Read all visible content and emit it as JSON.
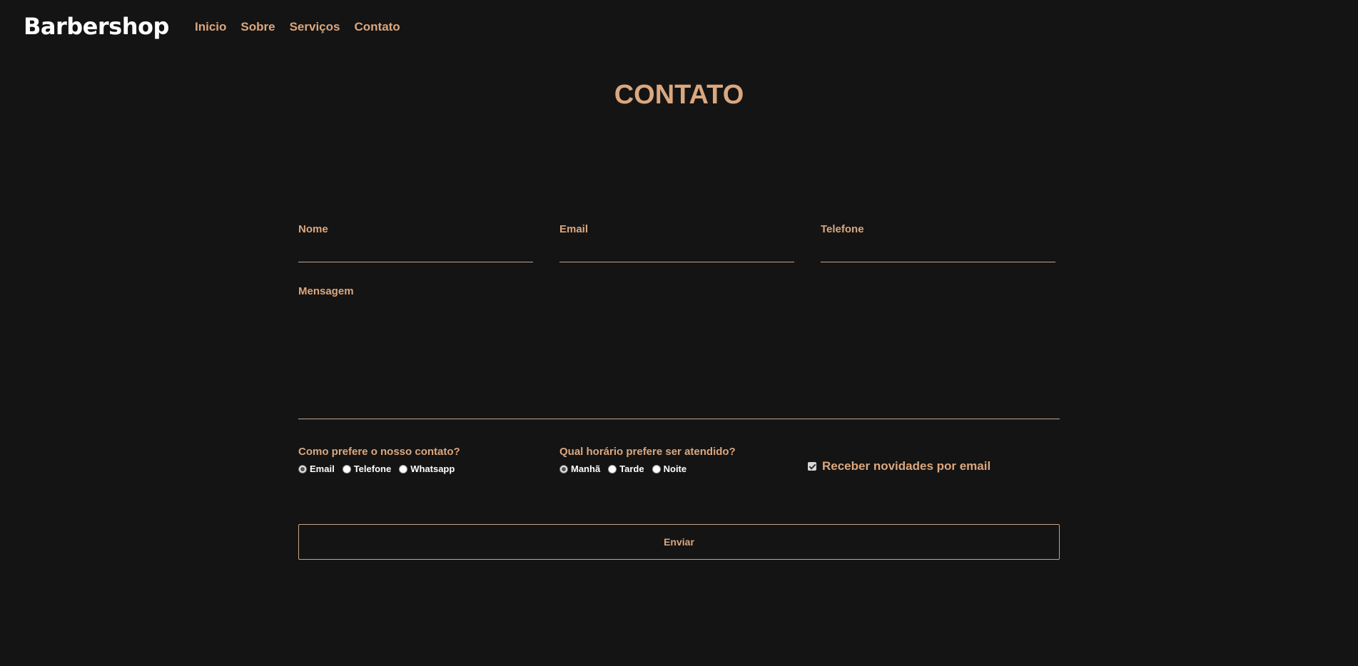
{
  "header": {
    "brand": "Barbershop",
    "nav": [
      "Inicio",
      "Sobre",
      "Serviços",
      "Contato"
    ]
  },
  "page": {
    "title": "CONTATO"
  },
  "form": {
    "fields": {
      "nome": {
        "label": "Nome",
        "value": ""
      },
      "email": {
        "label": "Email",
        "value": ""
      },
      "telefone": {
        "label": "Telefone",
        "value": ""
      },
      "mensagem": {
        "label": "Mensagem",
        "value": ""
      }
    },
    "contact_pref": {
      "question": "Como prefere o nosso contato?",
      "options": [
        "Email",
        "Telefone",
        "Whatsapp"
      ],
      "selected": "Email"
    },
    "time_pref": {
      "question": "Qual horário prefere ser atendido?",
      "options": [
        "Manhã",
        "Tarde",
        "Noite"
      ],
      "selected": "Manhã"
    },
    "newsletter": {
      "label": "Receber novidades por email",
      "checked": true
    },
    "submit_label": "Enviar"
  },
  "colors": {
    "background": "#141414",
    "accent": "#dba77e",
    "brand": "#ffffff",
    "underline": "#c9a485"
  }
}
